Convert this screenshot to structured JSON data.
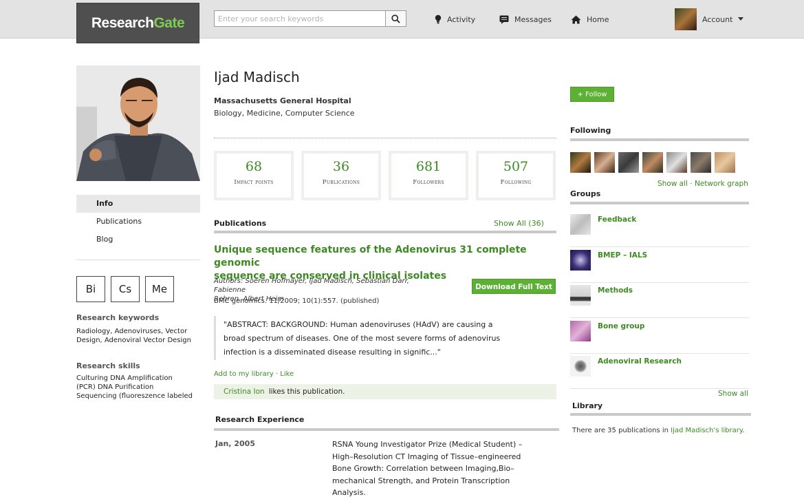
{
  "header": {
    "logo_text_1": "Research",
    "logo_text_2": "Gate",
    "search_placeholder": "Enter your search keywords",
    "nav": [
      {
        "label": "Activity",
        "icon": "lightbulb-icon"
      },
      {
        "label": "Messages",
        "icon": "message-icon"
      },
      {
        "label": "Home",
        "icon": "home-icon"
      }
    ],
    "account_label": "Account"
  },
  "sidebar": {
    "nav_items": [
      "Info",
      "Publications",
      "Blog"
    ],
    "active_item": "Info",
    "skill_tiles": [
      "Bi",
      "Cs",
      "Me"
    ],
    "keywords_label": "Research keywords",
    "keywords_lines": [
      "Radiology, Adenoviruses, Vector",
      "Design, Adenoviral Vector Design"
    ],
    "skills_label": "Research skills",
    "skills_lines": [
      "Culturing DNA Amplification",
      "(PCR) DNA Purification",
      "Sequencing (fluoreszence labeled"
    ]
  },
  "profile": {
    "name": "Ijad Madisch",
    "institution": "Massachusetts General Hospital",
    "fields": "Biology, Medicine, Computer Science",
    "stats": [
      {
        "value": "68",
        "label": "Impact points"
      },
      {
        "value": "36",
        "label": "Publications"
      },
      {
        "value": "681",
        "label": "Followers"
      },
      {
        "value": "507",
        "label": "Following"
      }
    ]
  },
  "publications": {
    "section_title": "Publications",
    "show_all": "Show All (36)",
    "item": {
      "title_lines": [
        "Unique sequence features of the Adenovirus 31 complete genomic",
        "sequence are conserved in clinical isolates"
      ],
      "authors_lines": [
        "Authors: Soeren Hofmayer, Ijad Madisch, Sebastian Darr, Fabienne",
        "Rehren, Albert Heim"
      ],
      "journal": "BMC genomics. 11/2009; 10(1):557. (published)",
      "download_label": "Download Full Text",
      "abstract_lines": [
        "\"ABSTRACT: BACKGROUND: Human adenoviruses (HAdV) are causing a",
        "broad spectrum of diseases. One of the most severe forms of adenovirus",
        "infection is a disseminated disease resulting in signific...\""
      ],
      "actions": "Add to my library · Like",
      "liked_by": "Cristina Ion",
      "likes_text": "likes this publication."
    }
  },
  "experience": {
    "section_title": "Research Experience",
    "date": "Jan, 2005",
    "desc_lines": [
      "RSNA Young Investigator Prize (Medical Student) –",
      "High–Resolution CT Imaging of Tissue–engineered",
      "Bone Growth: Correlation between Imaging,Bio–",
      "mechanical Strength, and Protein Transcription",
      "Analysis."
    ]
  },
  "right": {
    "follow_label": "+ Follow",
    "following_title": "Following",
    "following_links": "Show all · Network graph",
    "groups_title": "Groups",
    "groups": [
      "Feedback",
      "BMEP – IALS",
      "Methods",
      "Bone group",
      "Adenoviral Research"
    ],
    "groups_show_all": "Show all",
    "library_title": "Library",
    "library_prefix": "There are 35 publications in",
    "library_link_1": "Ijad Madisch's",
    "library_link_2": "library",
    "library_suffix": "."
  }
}
